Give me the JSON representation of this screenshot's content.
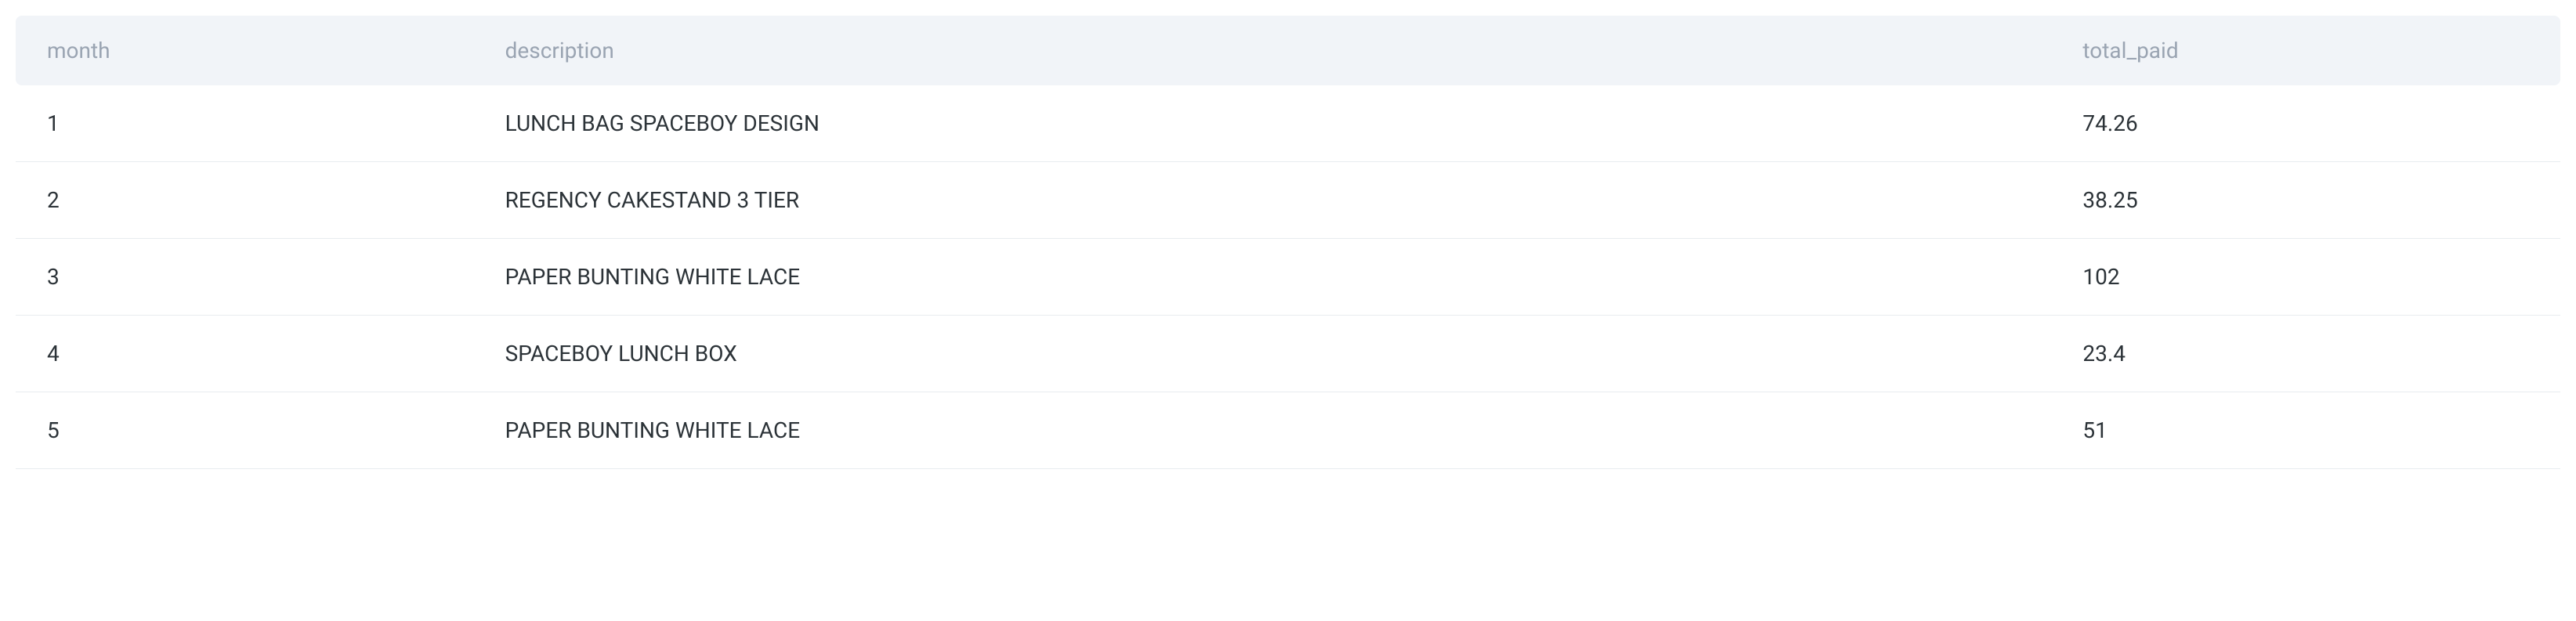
{
  "chart_data": {
    "type": "table",
    "columns": [
      "month",
      "description",
      "total_paid"
    ],
    "rows": [
      {
        "month": "1",
        "description": "LUNCH BAG SPACEBOY DESIGN",
        "total_paid": "74.26"
      },
      {
        "month": "2",
        "description": "REGENCY CAKESTAND 3 TIER",
        "total_paid": "38.25"
      },
      {
        "month": "3",
        "description": "PAPER BUNTING WHITE LACE",
        "total_paid": "102"
      },
      {
        "month": "4",
        "description": "SPACEBOY LUNCH BOX",
        "total_paid": "23.4"
      },
      {
        "month": "5",
        "description": "PAPER BUNTING WHITE LACE",
        "total_paid": "51"
      }
    ]
  },
  "table": {
    "headers": {
      "month": "month",
      "description": "description",
      "total_paid": "total_paid"
    },
    "rows": [
      {
        "month": "1",
        "description": "LUNCH BAG SPACEBOY DESIGN",
        "total_paid": "74.26"
      },
      {
        "month": "2",
        "description": "REGENCY CAKESTAND 3 TIER",
        "total_paid": "38.25"
      },
      {
        "month": "3",
        "description": "PAPER BUNTING WHITE LACE",
        "total_paid": "102"
      },
      {
        "month": "4",
        "description": "SPACEBOY LUNCH BOX",
        "total_paid": "23.4"
      },
      {
        "month": "5",
        "description": "PAPER BUNTING WHITE LACE",
        "total_paid": "51"
      }
    ]
  }
}
